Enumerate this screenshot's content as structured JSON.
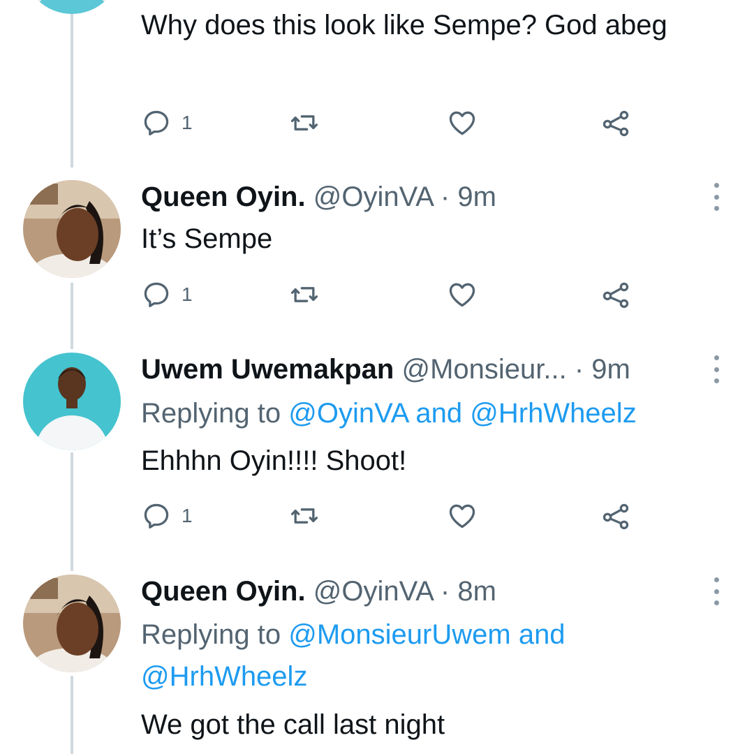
{
  "colors": {
    "link": "#1d9bf0",
    "muted": "#536471",
    "line": "#cfd9de",
    "icon": "#536471"
  },
  "icons": {
    "reply": "reply-icon",
    "retweet": "retweet-icon",
    "like": "heart-icon",
    "share": "share-icon",
    "more": "more-icon"
  },
  "top_tweet": {
    "text": "Why does this look like Sempe? God abeg",
    "reply_count": "1"
  },
  "tweets": [
    {
      "name": "Queen Oyin.",
      "handle": "@OyinVA",
      "sep": "·",
      "time": "9m",
      "text": "It’s Sempe",
      "reply_count": "1"
    },
    {
      "name": "Uwem Uwemakpan",
      "handle": "@Monsieur...",
      "sep": "·",
      "time": "9m",
      "replying_prefix": "Replying to ",
      "replying_mention1": "@OyinVA",
      "replying_and": " and ",
      "replying_mention2": "@HrhWheelz",
      "text": "Ehhhn Oyin!!!! Shoot!",
      "reply_count": "1"
    },
    {
      "name": "Queen Oyin.",
      "handle": "@OyinVA",
      "sep": "·",
      "time": "8m",
      "replying_prefix": "Replying to ",
      "replying_mention1": "@MonsieurUwem",
      "replying_and": " and ",
      "replying_mention2": "@HrhWheelz",
      "text": "We got the call last night"
    }
  ]
}
